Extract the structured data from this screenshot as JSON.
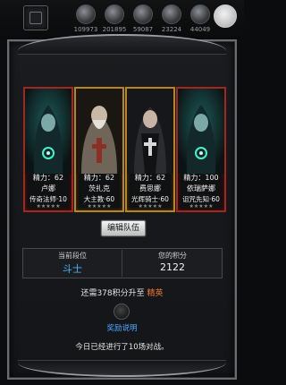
{
  "resources": [
    {
      "icon": "copper-coin-icon",
      "value": "109973"
    },
    {
      "icon": "iron-ore-icon",
      "value": "201895"
    },
    {
      "icon": "wood-icon",
      "value": "59087"
    },
    {
      "icon": "crystal-icon",
      "value": "23224"
    },
    {
      "icon": "stone-icon",
      "value": "44049"
    }
  ],
  "team": [
    {
      "power": "精力：62",
      "name": "卢娜",
      "class": "传奇法师·10",
      "border": "red"
    },
    {
      "power": "精力：62",
      "name": "茨扎克",
      "class": "大主教·60",
      "border": "gold"
    },
    {
      "power": "精力：62",
      "name": "费思娜",
      "class": "光辉骑士·60",
      "border": "gold"
    },
    {
      "power": "精力：100",
      "name": "依瑞萨娜",
      "class": "诅咒先知·60",
      "border": "red"
    }
  ],
  "edit_team_label": "编辑队伍",
  "rank": {
    "label": "当前段位",
    "value": "斗士"
  },
  "score": {
    "label": "您的积分",
    "value": "2122"
  },
  "upgrade": {
    "prefix": "还需378积分升至",
    "target": "精英"
  },
  "reward_info_label": "奖励说明",
  "today_text": "今日已经进行了10场对战。",
  "colors": {
    "rank_blue": "#4fb2ff",
    "accent_orange": "#f07a2f",
    "link_blue": "#4da6ff",
    "red_border": "#a3271f",
    "gold_border": "#b8861f"
  }
}
